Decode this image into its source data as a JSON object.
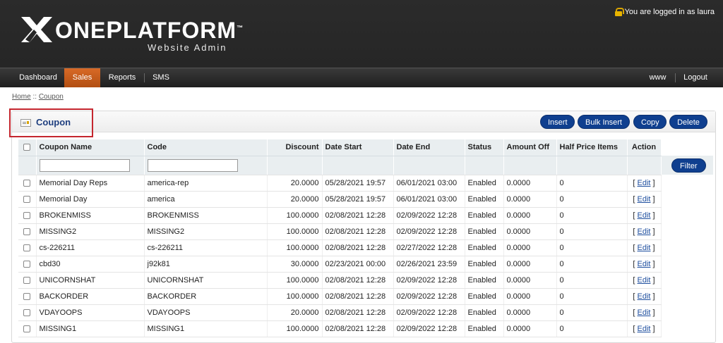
{
  "header": {
    "logo_word_one": "ONE",
    "logo_word_p": "P",
    "logo_word_rest": "LATFORM",
    "logo_tm": "™",
    "logo_sub": "Website Admin",
    "login_text": "You are logged in as laura"
  },
  "nav": {
    "items": [
      {
        "label": "Dashboard"
      },
      {
        "label": "Sales",
        "active": true
      },
      {
        "label": "Reports"
      },
      {
        "label": "SMS"
      }
    ],
    "right": [
      {
        "label": "www"
      },
      {
        "label": "Logout"
      }
    ]
  },
  "breadcrumb": {
    "home": "Home",
    "sep": " :: ",
    "current": "Coupon"
  },
  "panel": {
    "title": "Coupon",
    "buttons": {
      "insert": "Insert",
      "bulk_insert": "Bulk Insert",
      "copy": "Copy",
      "delete": "Delete"
    }
  },
  "table": {
    "columns": {
      "name": "Coupon Name",
      "code": "Code",
      "discount": "Discount",
      "date_start": "Date Start",
      "date_end": "Date End",
      "status": "Status",
      "amount_off": "Amount Off",
      "half_price": "Half Price Items",
      "action": "Action"
    },
    "filter_button": "Filter",
    "edit_label": "Edit",
    "rows": [
      {
        "name": "Memorial Day Reps",
        "code": "america-rep",
        "discount": "20.0000",
        "date_start": "05/28/2021 19:57",
        "date_end": "06/01/2021 03:00",
        "status": "Enabled",
        "amount_off": "0.0000",
        "half_price": "0"
      },
      {
        "name": "Memorial Day",
        "code": "america",
        "discount": "20.0000",
        "date_start": "05/28/2021 19:57",
        "date_end": "06/01/2021 03:00",
        "status": "Enabled",
        "amount_off": "0.0000",
        "half_price": "0"
      },
      {
        "name": "BROKENMISS",
        "code": "BROKENMISS",
        "discount": "100.0000",
        "date_start": "02/08/2021 12:28",
        "date_end": "02/09/2022 12:28",
        "status": "Enabled",
        "amount_off": "0.0000",
        "half_price": "0"
      },
      {
        "name": "MISSING2",
        "code": "MISSING2",
        "discount": "100.0000",
        "date_start": "02/08/2021 12:28",
        "date_end": "02/09/2022 12:28",
        "status": "Enabled",
        "amount_off": "0.0000",
        "half_price": "0"
      },
      {
        "name": "cs-226211",
        "code": "cs-226211",
        "discount": "100.0000",
        "date_start": "02/08/2021 12:28",
        "date_end": "02/27/2022 12:28",
        "status": "Enabled",
        "amount_off": "0.0000",
        "half_price": "0"
      },
      {
        "name": "cbd30",
        "code": "j92k81",
        "discount": "30.0000",
        "date_start": "02/23/2021 00:00",
        "date_end": "02/26/2021 23:59",
        "status": "Enabled",
        "amount_off": "0.0000",
        "half_price": "0"
      },
      {
        "name": "UNICORNSHAT",
        "code": "UNICORNSHAT",
        "discount": "100.0000",
        "date_start": "02/08/2021 12:28",
        "date_end": "02/09/2022 12:28",
        "status": "Enabled",
        "amount_off": "0.0000",
        "half_price": "0"
      },
      {
        "name": "BACKORDER",
        "code": "BACKORDER",
        "discount": "100.0000",
        "date_start": "02/08/2021 12:28",
        "date_end": "02/09/2022 12:28",
        "status": "Enabled",
        "amount_off": "0.0000",
        "half_price": "0"
      },
      {
        "name": "VDAYOOPS",
        "code": "VDAYOOPS",
        "discount": "20.0000",
        "date_start": "02/08/2021 12:28",
        "date_end": "02/09/2022 12:28",
        "status": "Enabled",
        "amount_off": "0.0000",
        "half_price": "0"
      },
      {
        "name": "MISSING1",
        "code": "MISSING1",
        "discount": "100.0000",
        "date_start": "02/08/2021 12:28",
        "date_end": "02/09/2022 12:28",
        "status": "Enabled",
        "amount_off": "0.0000",
        "half_price": "0"
      }
    ]
  },
  "colors": {
    "header_bg": "#262626",
    "nav_active": "#c75c1b",
    "button_blue": "#0f3f8f",
    "highlight_red": "#c4262e",
    "title_blue": "#1f3f7f"
  }
}
